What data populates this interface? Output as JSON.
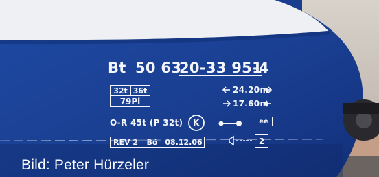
{
  "photo": {
    "subject": "Railway carriage side with white lettering on blue body",
    "colors": {
      "body_blue": "#1a3d8f",
      "white_band": "#eef0f3",
      "lettering": "#f4f6fb"
    }
  },
  "lettering": {
    "wagon_prefix": "Bt",
    "number_a": "50 63",
    "number_b": "20-33 951",
    "check_digit": "-4",
    "load_32t": "32t",
    "load_36t": "36t",
    "seats": "79Pl",
    "length_total": "24.20m",
    "length_bogies": "17.60m",
    "brake_regime": "O-R  45t  (P 32t)",
    "k_symbol": "K",
    "ee_symbol": "ee",
    "rev_label": "REV 2",
    "bo_label": "Bö",
    "rev_date": "08.12.06",
    "end_number": "2"
  },
  "credit": "Bild: Peter Hürzeler"
}
